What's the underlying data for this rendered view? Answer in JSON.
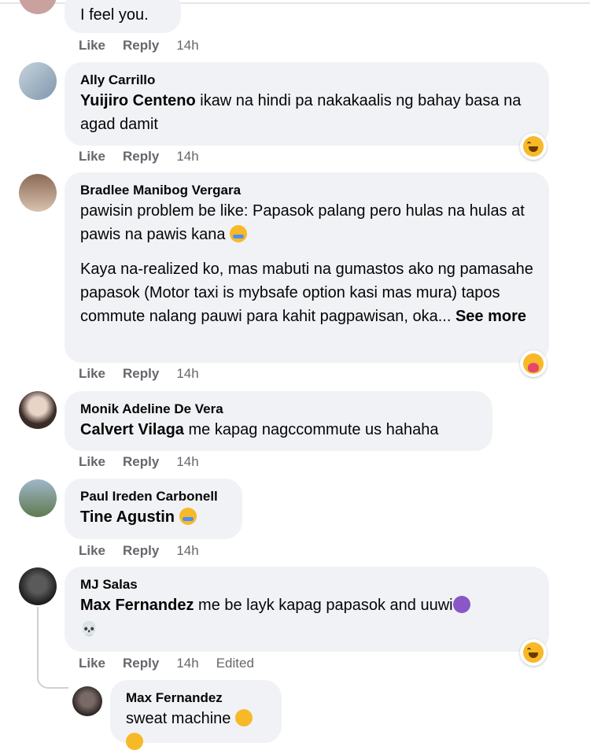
{
  "comments": [
    {
      "text": "I feel you.",
      "like": "Like",
      "reply": "Reply",
      "time": "14h"
    },
    {
      "author": "Ally Carrillo",
      "tag": "Yuijiro Centeno",
      "text": " ikaw na hindi pa nakakaalis ng bahay basa na agad damit",
      "like": "Like",
      "reply": "Reply",
      "time": "14h",
      "reaction": "haha-icon"
    },
    {
      "author": "Bradlee Manibog Vergara",
      "p1": "pawisin problem be like: Papasok palang pero hulas na hulas at pawis na pawis kana",
      "p2": "Kaya na-realized ko, mas mabuti na gumastos ako ng pamasahe papasok (Motor taxi is mybsafe option kasi mas mura) tapos commute nalang pauwi para kahit pagpawisan, oka...",
      "see_more": "See more",
      "like": "Like",
      "reply": "Reply",
      "time": "14h",
      "reaction": "care-icon"
    },
    {
      "author": "Monik Adeline De Vera",
      "tag": "Calvert Vilaga",
      "text": " me kapag nagccommute us hahaha",
      "like": "Like",
      "reply": "Reply",
      "time": "14h"
    },
    {
      "author": "Paul Ireden Carbonell",
      "tag": "Tine Agustin",
      "like": "Like",
      "reply": "Reply",
      "time": "14h"
    },
    {
      "author": "MJ Salas",
      "tag": "Max Fernandez",
      "text": " me be layk kapag papasok and uuwi",
      "like": "Like",
      "reply": "Reply",
      "time": "14h",
      "edited": "Edited",
      "reaction": "haha-icon"
    },
    {
      "author": "Max Fernandez",
      "text": "sweat machine"
    }
  ]
}
